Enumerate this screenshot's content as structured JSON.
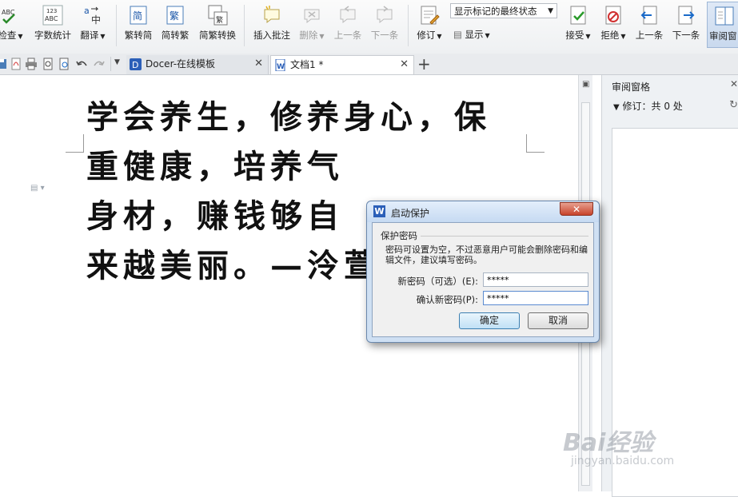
{
  "ribbon": {
    "spell_check": "检查",
    "word_count": "字数统计",
    "translate": "翻译",
    "trad_to_simp": "繁转简",
    "simp_to_trad": "简转繁",
    "trad_simp_convert": "简繁转换",
    "insert_comment": "插入批注",
    "delete": "删除",
    "previous_comment": "上一条",
    "next_comment": "下一条",
    "track_changes": "修订",
    "display_state": "显示标记的最终状态",
    "display": "显示",
    "accept": "接受",
    "reject": "拒绝",
    "previous_change": "上一条",
    "next_change": "下一条",
    "review_pane": "审阅窗"
  },
  "tabs": [
    {
      "label": "Docer-在线模板"
    },
    {
      "label": "文档1 *"
    }
  ],
  "document": {
    "lines": [
      "学会养生，修养身心，保",
      "重健康，培养气",
      "身材，赚钱够自",
      "来越美丽。—泠萱雨夢"
    ]
  },
  "review_panel": {
    "title": "审阅窗格",
    "count": "修订：共 0 处"
  },
  "dialog": {
    "title": "启动保护",
    "group_label": "保护密码",
    "description": "密码可设置为空，不过恶意用户可能会删除密码和编辑文件，建议填写密码。",
    "new_password_label": "新密码（可选）(E):",
    "new_password_value": "*****",
    "confirm_password_label": "确认新密码(P):",
    "confirm_password_value": "*****",
    "ok": "确定",
    "cancel": "取消"
  },
  "watermark": {
    "brand": "Bai经验",
    "url": "jingyan.baidu.com"
  },
  "colors": {
    "dialog_frame": "#cfe0f3",
    "close_button": "#c7432b",
    "review_button_active": "#c9d9ee",
    "doc_tab_icon": "#2b5fb8"
  }
}
